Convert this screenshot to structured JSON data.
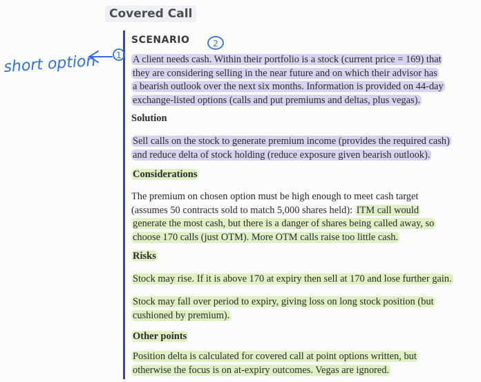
{
  "title": "Covered Call",
  "annotation": {
    "text": "short option",
    "marker_1": "1",
    "marker_2": "2",
    "ink_color": "#2f6fe0"
  },
  "colors": {
    "highlight_purple": "#d9d2ef",
    "highlight_green": "#dff0c4",
    "rule": "#3f4a78"
  },
  "scenario": {
    "label": "SCENARIO",
    "lines": [
      "A client needs cash. Within their portfolio is a stock (current price = 169) that",
      "they are considering selling in the near future and on which their advisor has",
      "a bearish outlook over the next six months. Information is provided on 44-day",
      "exchange-listed options (calls and put premiums and deltas, plus vegas)."
    ]
  },
  "solution": {
    "heading": "Solution",
    "lines": [
      "Sell calls on the stock to generate premium income (provides the required cash)",
      "and reduce delta of stock holding (reduce exposure given bearish outlook)."
    ]
  },
  "considerations": {
    "heading": "Considerations",
    "lines": [
      "The premium on chosen option must be high enough to meet cash target",
      "(assumes 50 contracts sold to match 5,000 shares held): ",
      "ITM call would",
      "generate the most cash, but there is a danger of shares being called away, so",
      "choose 170 calls (just OTM). More OTM calls raise too little cash."
    ]
  },
  "risks": {
    "heading": "Risks",
    "p1": "Stock may rise. If it is above 170 at expiry then sell at 170 and lose further gain.",
    "p2_lines": [
      "Stock may fall over period to expiry, giving loss on long stock position (but",
      "cushioned by premium)."
    ]
  },
  "other_points": {
    "heading": "Other points",
    "lines": [
      "Position delta is calculated for covered call at point options written, but",
      "otherwise the focus is on at-expiry outcomes. Vegas are ignored."
    ]
  }
}
